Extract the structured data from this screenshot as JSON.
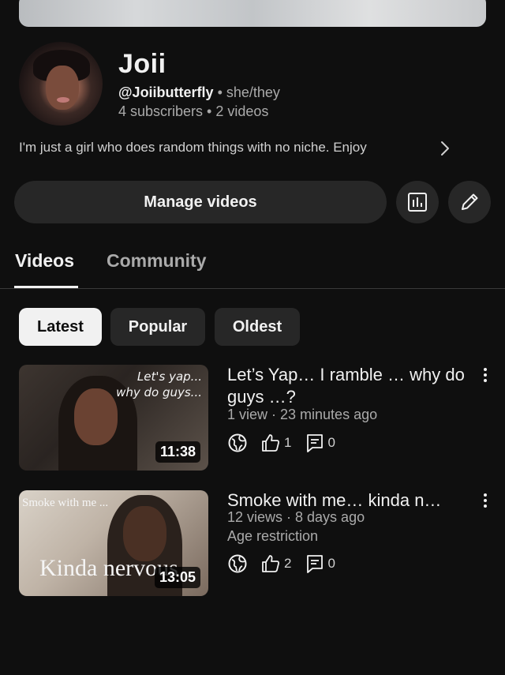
{
  "channel": {
    "name": "Joii",
    "handle": "@Joiibutterfly",
    "pronouns": "she/they",
    "subscribers": "4 subscribers",
    "videos_count": "2 videos",
    "separator": "•",
    "description": "I'm just a girl who does random things with no niche. Enjoy"
  },
  "actions": {
    "manage_label": "Manage videos"
  },
  "tabs": [
    {
      "label": "Videos",
      "active": true
    },
    {
      "label": "Community",
      "active": false
    }
  ],
  "chips": [
    {
      "label": "Latest",
      "active": true
    },
    {
      "label": "Popular",
      "active": false
    },
    {
      "label": "Oldest",
      "active": false
    }
  ],
  "videos": [
    {
      "title": "Let’s Yap… I ramble … why do guys …?",
      "meta": "1 view · 23 minutes ago",
      "duration": "11:38",
      "likes": "1",
      "comments": "0",
      "thumb_caption_1": "Let's yap...",
      "thumb_caption_2": "why do guys..."
    },
    {
      "title": "Smoke with me… kinda n…",
      "meta": "12 views · 8 days ago",
      "restriction": "Age restriction",
      "duration": "13:05",
      "likes": "2",
      "comments": "0",
      "thumb_caption_1": "Smoke with me ...",
      "thumb_caption_2": "Kinda nervous"
    }
  ],
  "icons": {
    "analytics": "analytics-icon",
    "edit": "pencil-icon",
    "chevron": "chevron-right-icon",
    "visibility": "globe-icon",
    "like": "thumbs-up-icon",
    "comment": "comment-icon",
    "more": "more-vertical-icon"
  },
  "colors": {
    "background": "#0f0f0f",
    "surface": "#272727",
    "text": "#f1f1f1",
    "muted": "#aaaaaa"
  }
}
